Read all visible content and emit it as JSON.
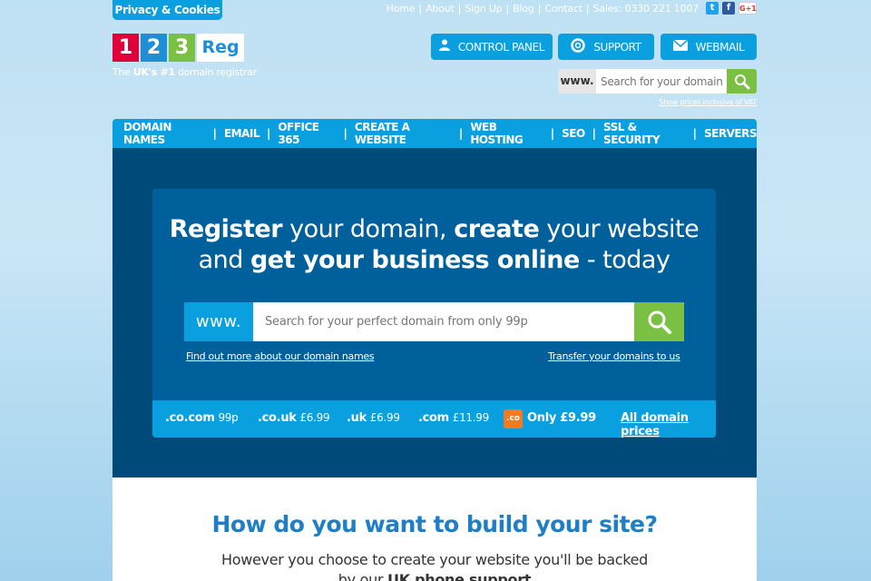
{
  "privacy": "Privacy & Cookies",
  "toplinks": [
    "Home",
    "About",
    "Sign Up",
    "Blog",
    "Contact"
  ],
  "sales": "Sales: 0330 221 1007",
  "social": {
    "twitter": "t",
    "facebook": "f",
    "gplus": "G+1"
  },
  "logo": {
    "d1": "1",
    "d2": "2",
    "d3": "3",
    "reg": "Reg"
  },
  "tagline": {
    "pre": "The ",
    "strong": "UK's #1",
    "post": " domain registrar"
  },
  "buttons": {
    "control_panel": "CONTROL PANEL",
    "support": "SUPPORT",
    "webmail": "WEBMAIL"
  },
  "small_search": {
    "prefix": "www.",
    "placeholder": "Search for your domain"
  },
  "vat_note": "Show prices inclusive of VAT",
  "nav": [
    "DOMAIN NAMES",
    "EMAIL",
    "OFFICE 365",
    "CREATE A WEBSITE",
    "WEB HOSTING",
    "SEO",
    "SSL & SECURITY",
    "SERVERS"
  ],
  "hero": {
    "l1_b1": "Register",
    "l1_t1": " your domain, ",
    "l1_b2": "create",
    "l1_t2": " your website",
    "l2_t1": "and ",
    "l2_b1": "get your business online",
    "l2_t2": " - today"
  },
  "big_search": {
    "prefix": "www.",
    "placeholder": "Search for your perfect domain from only 99p"
  },
  "links": {
    "find_more": "Find out more about our domain names",
    "transfer": "Transfer your domains to us"
  },
  "prices": [
    {
      "tld": ".co.com",
      "price": "99p"
    },
    {
      "tld": ".co.uk",
      "price": "£6.99"
    },
    {
      "tld": ".uk",
      "price": "£6.99"
    },
    {
      "tld": ".com",
      "price": "£11.99"
    }
  ],
  "co_offer": {
    "badge": ".co",
    "text": "Only £9.99"
  },
  "all_prices": "All domain prices",
  "build": {
    "title": "How do you want to build your site?",
    "sub1": "However you choose to create your website you'll be backed",
    "sub2_pre": "by our ",
    "sub2_strong": "UK phone support"
  },
  "colors": {
    "accent": "#0aa0e0",
    "green": "#7ac143",
    "navy": "#004a7a",
    "hero_box": "#00609c",
    "heading": "#1e7fc6"
  }
}
